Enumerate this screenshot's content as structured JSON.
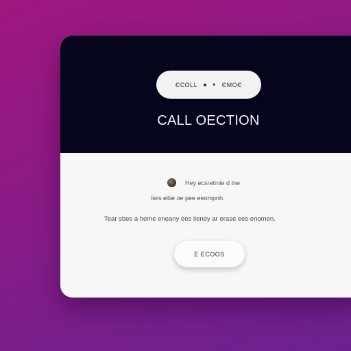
{
  "header": {
    "pill": {
      "left_text": "ЄСОLL",
      "right_text": "ЄМОЄ",
      "chevron": "▾"
    },
    "title": "CALL OECTION"
  },
  "body": {
    "meta_text": "Hey ecsretmie d Ine",
    "line_2": "Iers eibe oe pee eeompnh.",
    "line_3": "Tear sbes a heme eneany ees lieney ar erase ees enomen.",
    "button_label": "E ECOOS"
  },
  "colors": {
    "background_start": "#a0177f",
    "background_end": "#6a2290",
    "card_header": "#05051c",
    "card_body": "#f7f7f7"
  }
}
